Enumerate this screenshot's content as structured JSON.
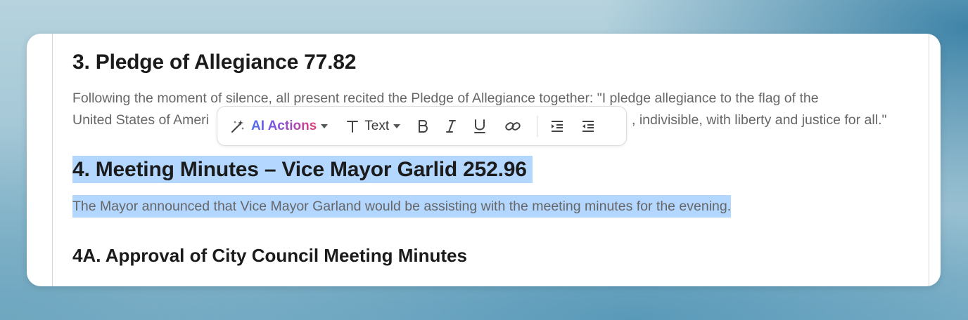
{
  "document": {
    "heading3": "3. Pledge of Allegiance 77.82",
    "para3_line1": "Following the moment of silence, all present recited the Pledge of Allegiance together: \"I pledge allegiance to the flag of the",
    "para3_line2_start": "United States of Ameri",
    "para3_line2_end": ", indivisible, with liberty and justice for all.\"",
    "heading4": "4. Meeting Minutes – Vice Mayor Garlid 252.96",
    "para4": "The Mayor announced that Vice Mayor Garland would be assisting with the meeting minutes for the evening.",
    "heading4a": "4A. Approval of City Council Meeting Minutes"
  },
  "toolbar": {
    "ai_actions_label": "AI Actions",
    "text_label": "Text",
    "icons": [
      "magic-wand-icon",
      "text-type-icon",
      "bold-icon",
      "italic-icon",
      "underline-icon",
      "link-icon",
      "indent-icon",
      "outdent-icon"
    ]
  },
  "colors": {
    "selection": "#b3d7ff",
    "ai_gradient_start": "#4f6ef0",
    "ai_gradient_end": "#e0407a"
  }
}
